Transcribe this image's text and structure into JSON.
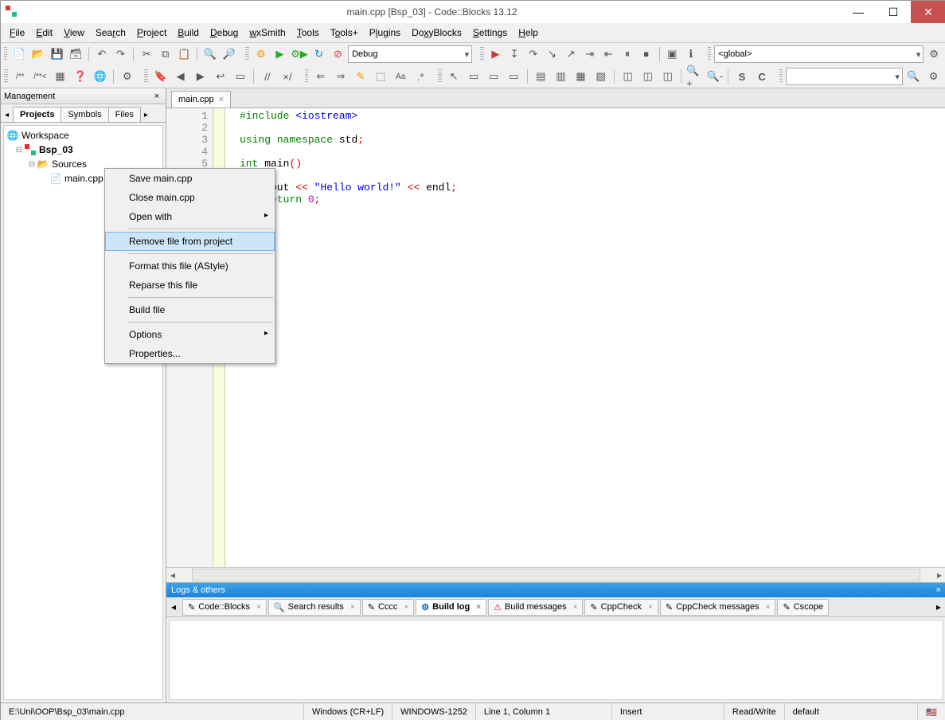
{
  "titlebar": {
    "title": "main.cpp [Bsp_03] - Code::Blocks 13.12"
  },
  "menu": {
    "file": "File",
    "edit": "Edit",
    "view": "View",
    "search": "Search",
    "project": "Project",
    "build": "Build",
    "debug": "Debug",
    "wxsmith": "wxSmith",
    "tools": "Tools",
    "toolsplus": "Tools+",
    "plugins": "Plugins",
    "doxyblocks": "DoxyBlocks",
    "settings": "Settings",
    "help": "Help"
  },
  "toolbar": {
    "config": "Debug",
    "target": "<global>",
    "search_placeholder": ""
  },
  "management": {
    "title": "Management",
    "tabs": {
      "projects": "Projects",
      "symbols": "Symbols",
      "files": "Files"
    },
    "tree": {
      "workspace": "Workspace",
      "project": "Bsp_03",
      "sources": "Sources",
      "file": "main.cpp"
    }
  },
  "editor": {
    "tab": "main.cpp",
    "lines": [
      "1",
      "2",
      "3",
      "4",
      "5"
    ],
    "code_lines": [
      "#include <iostream>",
      "",
      "using namespace std;",
      "",
      "int main()",
      "",
      "    cout << \"Hello world!\" << endl;",
      "    return 0;",
      ""
    ]
  },
  "context": {
    "save": "Save main.cpp",
    "close": "Close main.cpp",
    "openwith": "Open with",
    "remove": "Remove file from project",
    "format": "Format this file (AStyle)",
    "reparse": "Reparse this file",
    "buildfile": "Build file",
    "options": "Options",
    "properties": "Properties..."
  },
  "logs": {
    "title": "Logs & others",
    "tabs": {
      "cb": "Code::Blocks",
      "search": "Search results",
      "cccc": "Cccc",
      "buildlog": "Build log",
      "buildmsg": "Build messages",
      "cppcheck": "CppCheck",
      "cppcheckmsg": "CppCheck messages",
      "cscope": "Cscope"
    }
  },
  "status": {
    "path": "E:\\Uni\\OOP\\Bsp_03\\main.cpp",
    "eol": "Windows (CR+LF)",
    "encoding": "WINDOWS-1252",
    "pos": "Line 1, Column 1",
    "mode": "Insert",
    "rw": "Read/Write",
    "lang": "default"
  }
}
